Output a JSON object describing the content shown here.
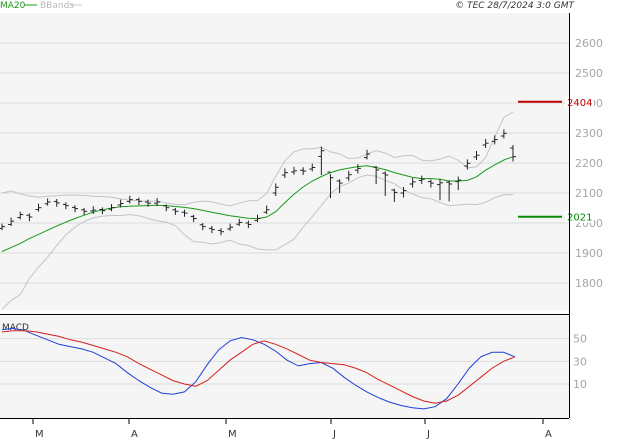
{
  "header": {
    "legend_ma": "MA20",
    "legend_bb": "BBands",
    "copyright": "© TEC 28/7/2024 3:0 GMT"
  },
  "colors": {
    "ma20": "#1a9a1a",
    "bbands": "#c4c4c4",
    "price_bars": "#222222",
    "resistance": "#c00000",
    "support": "#0a8a0a",
    "macd_line": "#1f3fd6",
    "signal_line": "#d42020",
    "grid": "#dcdcdc"
  },
  "chart_data": [
    {
      "type": "ohlc",
      "panel": "price",
      "ylim": [
        1710,
        2700
      ],
      "yticks": [
        1800,
        1900,
        2000,
        2100,
        2200,
        2300,
        2400,
        2500,
        2600
      ],
      "x_month_labels": [
        "M",
        "A",
        "M",
        "J",
        "J",
        "A"
      ],
      "grid": true,
      "legend_placement": "top-left",
      "levels": [
        {
          "label": "2404",
          "value": 2404,
          "kind": "resistance"
        },
        {
          "label": "2021",
          "value": 2021,
          "kind": "support"
        }
      ],
      "series": [
        {
          "name": "MA20",
          "kind": "line",
          "values": [
            1905,
            1918,
            1932,
            1948,
            1962,
            1976,
            1990,
            2003,
            2015,
            2026,
            2036,
            2044,
            2050,
            2054,
            2056,
            2057,
            2058,
            2059,
            2058,
            2055,
            2052,
            2048,
            2042,
            2036,
            2030,
            2024,
            2020,
            2016,
            2014,
            2020,
            2038,
            2068,
            2096,
            2120,
            2140,
            2155,
            2168,
            2177,
            2183,
            2188,
            2191,
            2185,
            2178,
            2168,
            2160,
            2152,
            2148,
            2148,
            2146,
            2140,
            2140,
            2142,
            2154,
            2176,
            2194,
            2210,
            2221
          ]
        },
        {
          "name": "BBands",
          "kind": "band",
          "upper": [
            2100,
            2107,
            2097,
            2090,
            2086,
            2089,
            2091,
            2093,
            2093,
            2092,
            2089,
            2088,
            2086,
            2080,
            2076,
            2074,
            2073,
            2073,
            2067,
            2062,
            2061,
            2069,
            2073,
            2071,
            2063,
            2057,
            2066,
            2074,
            2075,
            2098,
            2156,
            2207,
            2237,
            2247,
            2247,
            2252,
            2237,
            2231,
            2215,
            2217,
            2230,
            2241,
            2233,
            2218,
            2224,
            2225,
            2209,
            2207,
            2213,
            2223,
            2209,
            2184,
            2187,
            2218,
            2287,
            2352,
            2370
          ],
          "lower": [
            1712,
            1742,
            1762,
            1815,
            1853,
            1886,
            1925,
            1961,
            1986,
            2005,
            2017,
            2023,
            2025,
            2025,
            2028,
            2024,
            2015,
            2007,
            2003,
            1991,
            1961,
            1938,
            1936,
            1930,
            1935,
            1943,
            1930,
            1925,
            1913,
            1911,
            1910,
            1928,
            1946,
            1986,
            2021,
            2058,
            2097,
            2122,
            2133,
            2151,
            2160,
            2156,
            2142,
            2131,
            2111,
            2097,
            2085,
            2081,
            2068,
            2058,
            2060,
            2063,
            2061,
            2069,
            2085,
            2094,
            2095
          ]
        },
        {
          "name": "Price",
          "kind": "ohlc",
          "close": [
            1988,
            2006,
            2028,
            2020,
            2051,
            2070,
            2067,
            2058,
            2048,
            2039,
            2043,
            2041,
            2051,
            2065,
            2078,
            2072,
            2066,
            2070,
            2051,
            2039,
            2033,
            2015,
            1988,
            1978,
            1971,
            1986,
            2002,
            1995,
            2015,
            2044,
            2119,
            2168,
            2174,
            2173,
            2185,
            2241,
            2151,
            2133,
            2161,
            2182,
            2230,
            2177,
            2160,
            2102,
            2108,
            2137,
            2146,
            2133,
            2134,
            2130,
            2143,
            2199,
            2226,
            2266,
            2278,
            2299,
            2221
          ],
          "high": [
            1998,
            2018,
            2038,
            2032,
            2064,
            2082,
            2080,
            2069,
            2059,
            2050,
            2056,
            2052,
            2063,
            2078,
            2091,
            2085,
            2078,
            2083,
            2062,
            2050,
            2044,
            2027,
            2000,
            1990,
            1983,
            1998,
            2014,
            2008,
            2028,
            2058,
            2132,
            2182,
            2187,
            2186,
            2198,
            2255,
            2163,
            2146,
            2174,
            2196,
            2244,
            2190,
            2172,
            2114,
            2120,
            2150,
            2158,
            2145,
            2146,
            2142,
            2155,
            2212,
            2240,
            2280,
            2292,
            2312,
            2260
          ],
          "low": [
            1976,
            1990,
            2012,
            2006,
            2038,
            2058,
            2054,
            2046,
            2036,
            2027,
            2030,
            2029,
            2039,
            2052,
            2065,
            2060,
            2054,
            2057,
            2039,
            2027,
            2021,
            2003,
            1976,
            1966,
            1959,
            1974,
            1990,
            1983,
            2003,
            2030,
            2090,
            2150,
            2161,
            2160,
            2172,
            2160,
            2083,
            2100,
            2140,
            2165,
            2212,
            2130,
            2090,
            2070,
            2085,
            2118,
            2130,
            2118,
            2076,
            2072,
            2110,
            2178,
            2210,
            2250,
            2262,
            2282,
            2205
          ],
          "open": [
            1982,
            1995,
            2018,
            2026,
            2045,
            2064,
            2072,
            2062,
            2052,
            2044,
            2040,
            2045,
            2046,
            2060,
            2072,
            2078,
            2070,
            2066,
            2057,
            2044,
            2036,
            2022,
            1994,
            1982,
            1975,
            1980,
            1996,
            2000,
            2008,
            2036,
            2100,
            2160,
            2170,
            2176,
            2180,
            2222,
            2170,
            2140,
            2150,
            2176,
            2218,
            2186,
            2166,
            2110,
            2100,
            2130,
            2142,
            2138,
            2128,
            2136,
            2138,
            2190,
            2220,
            2260,
            2272,
            2290,
            2250
          ]
        }
      ]
    },
    {
      "type": "line",
      "panel": "macd",
      "title": "MACD",
      "ylim": [
        -20,
        70
      ],
      "yticks": [
        10,
        30,
        50
      ],
      "ytick_labels": [
        "10",
        "30",
        "50"
      ],
      "series": [
        {
          "name": "MACD",
          "values": [
            58,
            59,
            57,
            53,
            49,
            45,
            43,
            41,
            38,
            33,
            28,
            20,
            13,
            7,
            2,
            1,
            3,
            12,
            27,
            40,
            48,
            51,
            49,
            45,
            39,
            31,
            26,
            28,
            29,
            24,
            16,
            9,
            3,
            -2,
            -6,
            -9,
            -11,
            -12,
            -10,
            -3,
            10,
            24,
            34,
            38,
            38,
            34
          ]
        },
        {
          "name": "Signal",
          "values": [
            56,
            57,
            57,
            56,
            54,
            52,
            49,
            47,
            44,
            41,
            38,
            34,
            28,
            23,
            18,
            13,
            10,
            8,
            13,
            22,
            31,
            38,
            45,
            48,
            45,
            41,
            36,
            31,
            29,
            28,
            27,
            24,
            20,
            14,
            9,
            4,
            -1,
            -5,
            -7,
            -5,
            0,
            8,
            16,
            24,
            30,
            34
          ]
        }
      ]
    }
  ]
}
